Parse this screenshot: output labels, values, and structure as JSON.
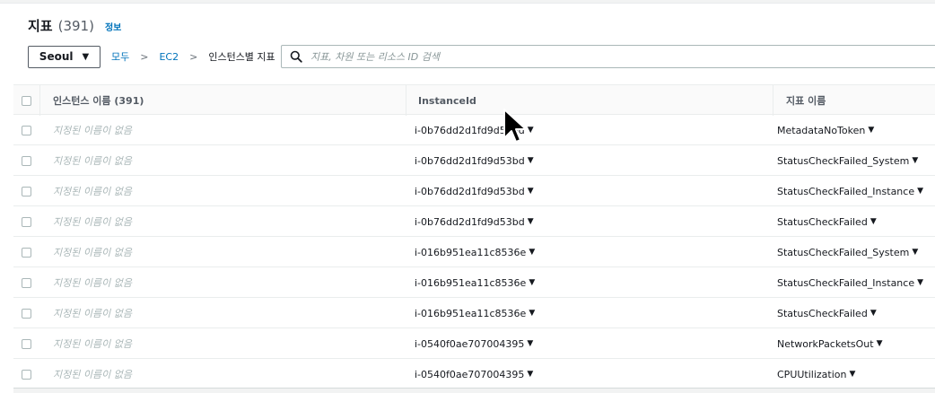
{
  "header": {
    "title": "지표",
    "count": "(391)",
    "info_link": "정보"
  },
  "controls": {
    "region": "Seoul",
    "breadcrumb": [
      "모두",
      "EC2",
      "인스턴스별 지표"
    ],
    "search_placeholder": "지표, 차원 또는 리소스 ID 검색"
  },
  "table": {
    "columns": {
      "name": "인스턴스 이름 (391)",
      "instance_id": "InstanceId",
      "metric": "지표 이름"
    },
    "rows": [
      {
        "name": "지정된 이름이 없음",
        "instance_id": "i-0b76dd2d1fd9d53bd",
        "metric": "MetadataNoToken"
      },
      {
        "name": "지정된 이름이 없음",
        "instance_id": "i-0b76dd2d1fd9d53bd",
        "metric": "StatusCheckFailed_System"
      },
      {
        "name": "지정된 이름이 없음",
        "instance_id": "i-0b76dd2d1fd9d53bd",
        "metric": "StatusCheckFailed_Instance"
      },
      {
        "name": "지정된 이름이 없음",
        "instance_id": "i-0b76dd2d1fd9d53bd",
        "metric": "StatusCheckFailed"
      },
      {
        "name": "지정된 이름이 없음",
        "instance_id": "i-016b951ea11c8536e",
        "metric": "StatusCheckFailed_System"
      },
      {
        "name": "지정된 이름이 없음",
        "instance_id": "i-016b951ea11c8536e",
        "metric": "StatusCheckFailed_Instance"
      },
      {
        "name": "지정된 이름이 없음",
        "instance_id": "i-016b951ea11c8536e",
        "metric": "StatusCheckFailed"
      },
      {
        "name": "지정된 이름이 없음",
        "instance_id": "i-0540f0ae707004395",
        "metric": "NetworkPacketsOut"
      },
      {
        "name": "지정된 이름이 없음",
        "instance_id": "i-0540f0ae707004395",
        "metric": "CPUUtilization"
      }
    ]
  },
  "icons": {
    "search": "search-icon",
    "region_caret": "caret-down-icon",
    "breadcrumb_separator": "chevron-right-icon",
    "cell_dropdown": "caret-down-icon",
    "cursor": "mouse-pointer-icon"
  },
  "colors": {
    "link": "#0073bb",
    "muted_text": "#aab7b8",
    "header_bg": "#fafafa",
    "border": "#eaeded"
  }
}
